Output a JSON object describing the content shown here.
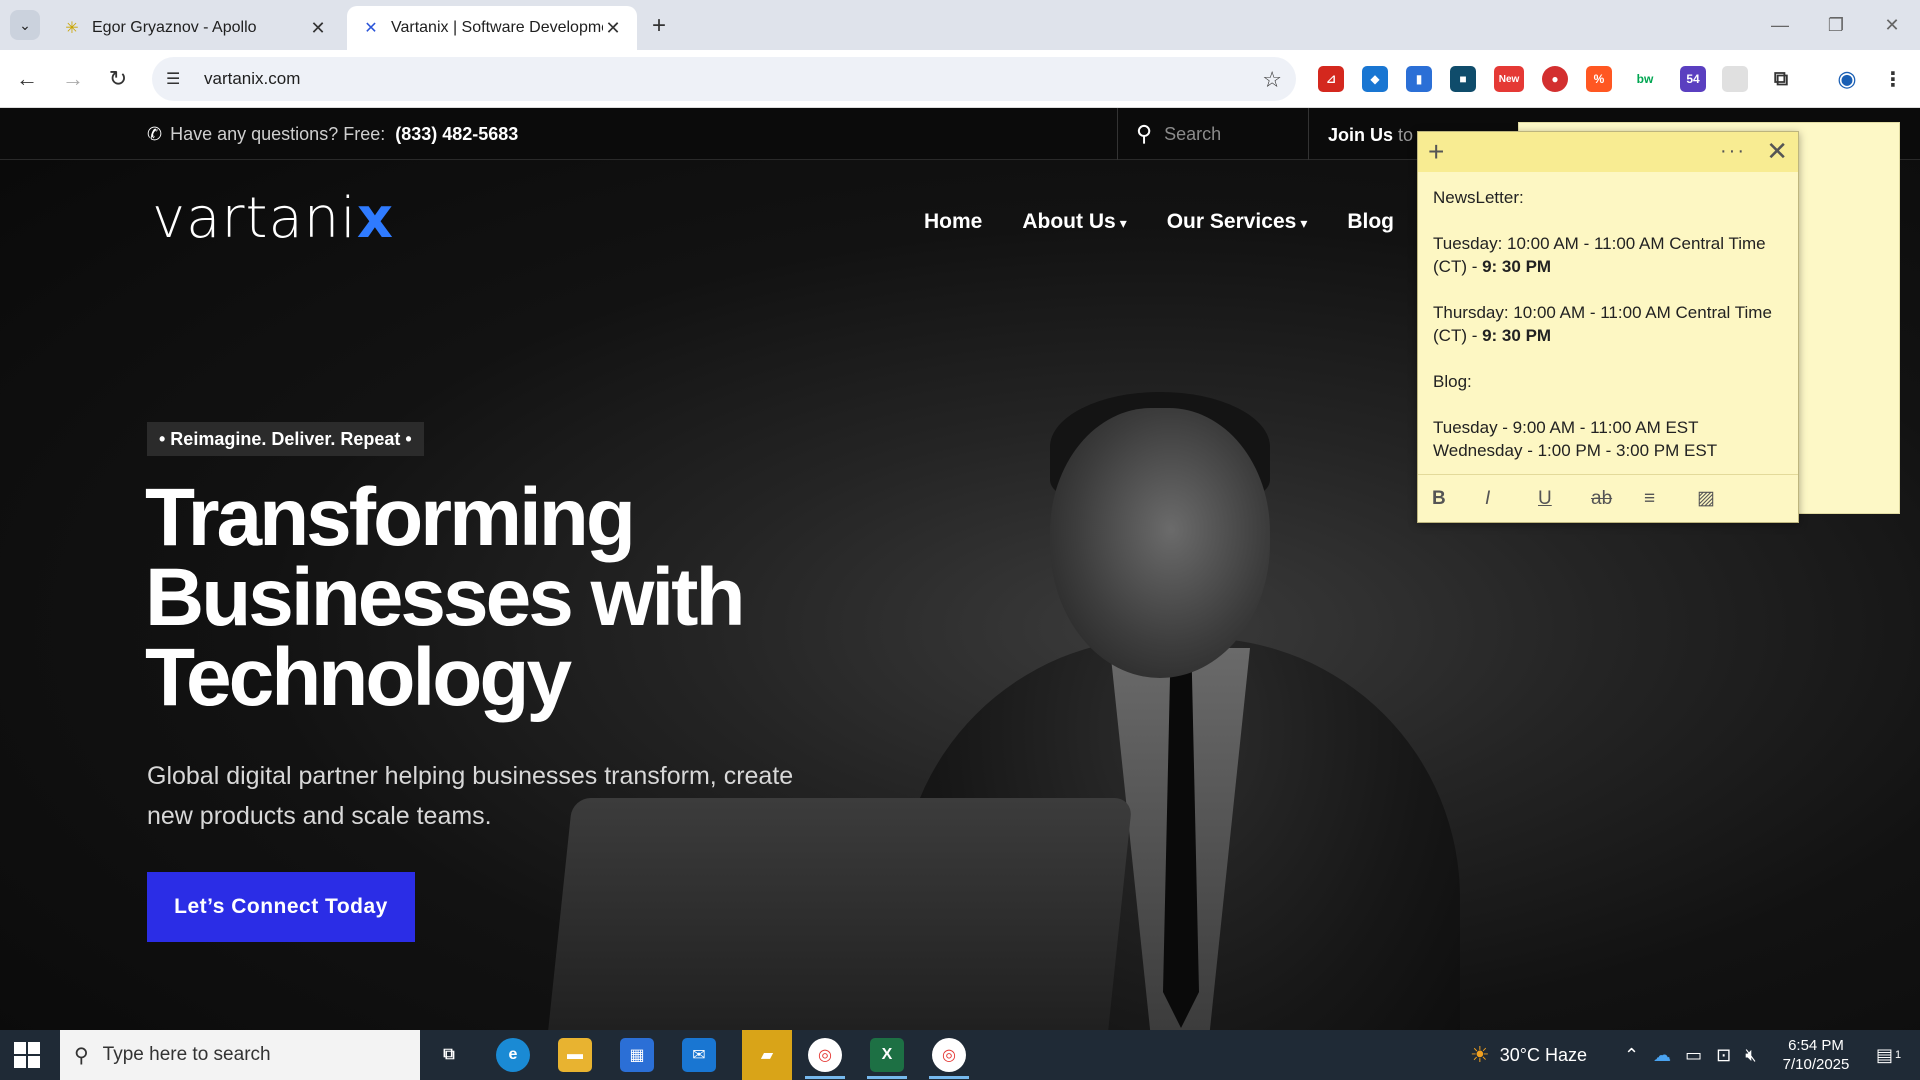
{
  "browser": {
    "tabs": [
      {
        "title": "Egor Gryaznov - Apollo",
        "favicon": "apollo-icon",
        "active": false
      },
      {
        "title": "Vartanix | Software Developmen",
        "favicon": "vartanix-icon",
        "active": true
      }
    ],
    "url": "vartanix.com",
    "extensions": [
      {
        "name": "pdf-icon",
        "color": "#d4281e",
        "label": "⊿"
      },
      {
        "name": "shield-icon",
        "color": "#1976d2",
        "label": "◆"
      },
      {
        "name": "book-icon",
        "color": "#2b6fd6",
        "label": "▮"
      },
      {
        "name": "folder-icon",
        "color": "#0f4c6b",
        "label": "■"
      },
      {
        "name": "new-badge-icon",
        "color": "#e53935",
        "label": "New"
      },
      {
        "name": "pokeball-icon",
        "color": "#d32f2f",
        "label": "●"
      },
      {
        "name": "percent-icon",
        "color": "#ff5722",
        "label": "%"
      },
      {
        "name": "bw-icon",
        "color": "#00a651",
        "label": "bw"
      },
      {
        "name": "grad-cap-icon",
        "color": "#5a3fc0",
        "label": "54"
      },
      {
        "name": "blank-ext-icon",
        "color": "#e0e0e0",
        "label": ""
      }
    ]
  },
  "site": {
    "topbar": {
      "question": "Have any questions? Free:",
      "phone": "(833) 482-5683",
      "search_placeholder": "Search",
      "join_bold": "Join Us",
      "join_rest": " to s"
    },
    "logo_main": "vartani",
    "logo_accent": "x",
    "nav": {
      "home": "Home",
      "about": "About Us",
      "services": "Our Services",
      "blog": "Blog"
    },
    "hero": {
      "eyebrow": "• Reimagine. Deliver. Repeat •",
      "headline_1": "Transforming",
      "headline_2": "Businesses with",
      "headline_3": "Technology",
      "subhead": "Global digital partner helping businesses transform, create new products and scale teams.",
      "cta": "Let’s Connect Today"
    }
  },
  "sticky_note": {
    "line1": "NewsLetter:",
    "line2a": "Tuesday: 10:00 AM - 11:00 AM Central Time (CT) - ",
    "line2b": "9: 30 PM",
    "line3a": "Thursday: 10:00 AM - 11:00 AM Central Time (CT) - ",
    "line3b": "9: 30 PM",
    "line4": "Blog:",
    "line5": "Tuesday - 9:00 AM - 11:00 AM EST",
    "line6": "Wednesday - 1:00 PM - 3:00 PM EST",
    "format_buttons": [
      "B",
      "I",
      "U",
      "ab",
      "≡",
      "▨"
    ]
  },
  "taskbar": {
    "search_placeholder": "Type here to search",
    "weather": "30°C  Haze",
    "time": "6:54 PM",
    "date": "7/10/2025",
    "notification_count": "1"
  }
}
